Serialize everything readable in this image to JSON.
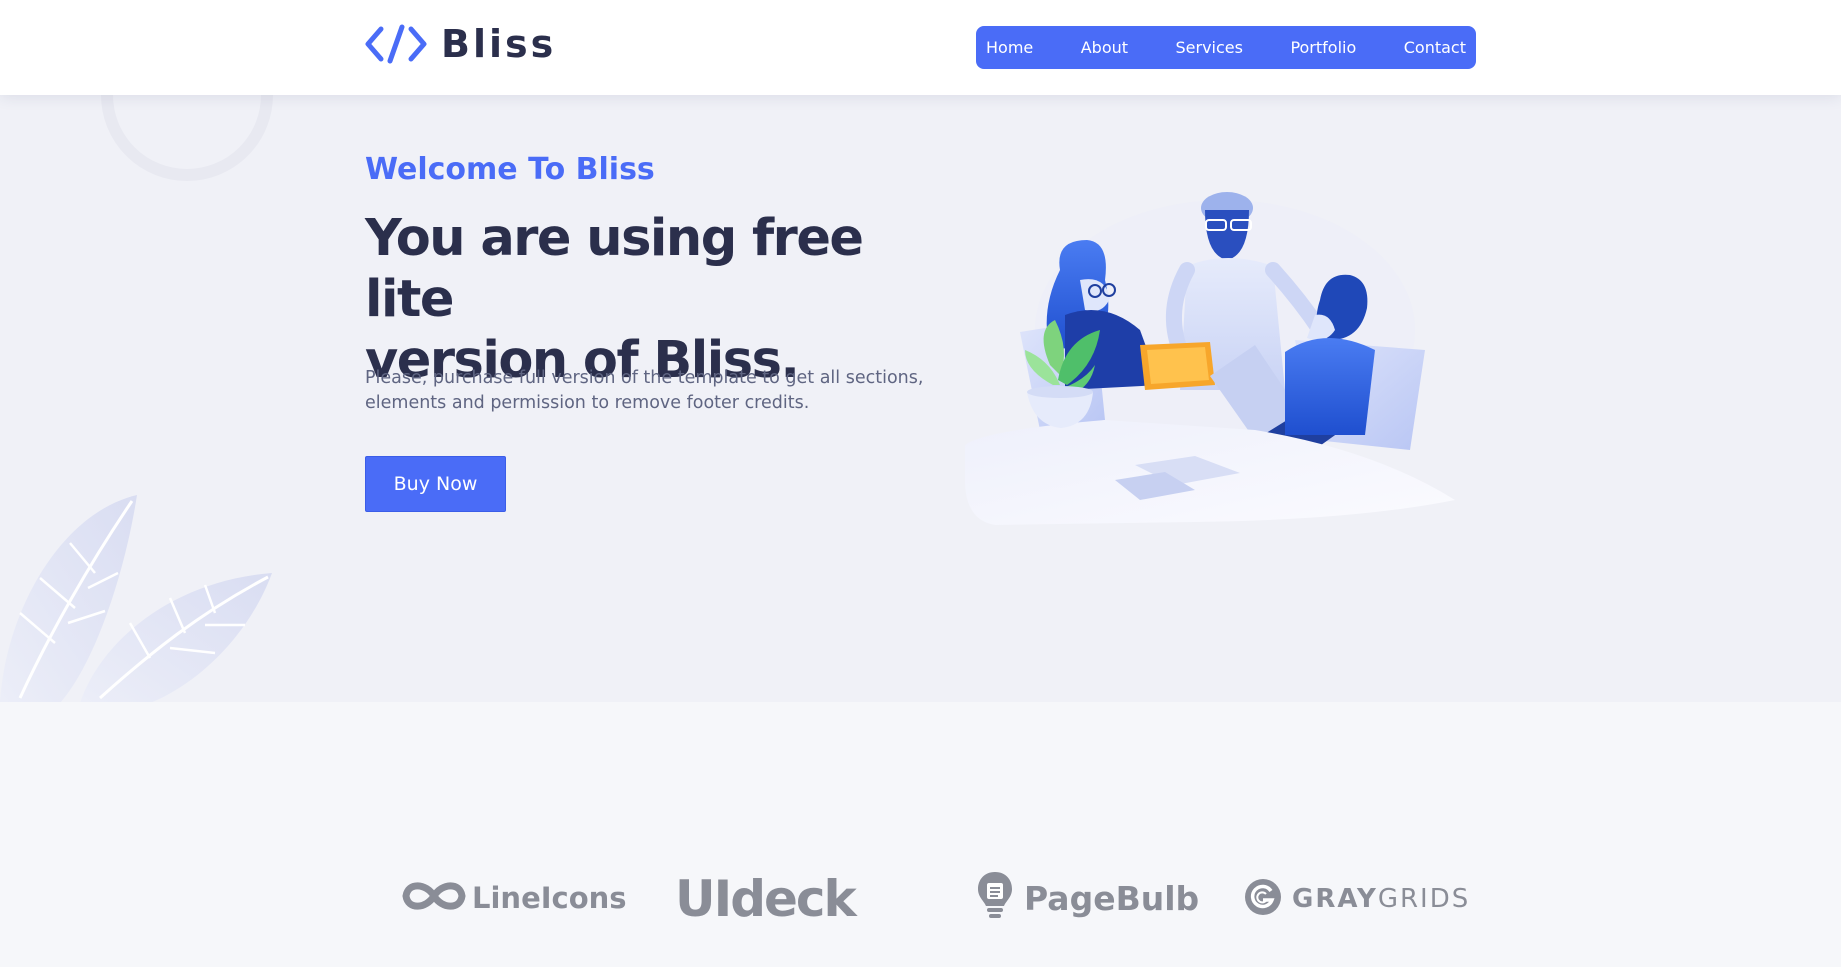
{
  "brand": {
    "name": "Bliss"
  },
  "nav": {
    "items": [
      "Home",
      "About",
      "Services",
      "Portfolio",
      "Contact"
    ]
  },
  "hero": {
    "kicker": "Welcome To Bliss",
    "headline_line1": "You are using free lite",
    "headline_line2": "version of Bliss.",
    "description_line1": "Please, purchase full version of the template to get all sections,",
    "description_line2": "elements and permission to remove footer credits.",
    "cta_label": "Buy Now"
  },
  "partners": {
    "lineicons": "LineIcons",
    "uideck": "UIdeck",
    "pagebulb": "PageBulb",
    "graygrids_gray": "GRAY",
    "graygrids_grids": "GRIDS"
  },
  "colors": {
    "accent": "#4a6cf7",
    "heading": "#2b2f4c",
    "body_text": "#5f6582",
    "logo_gray": "#8a8d97"
  },
  "icons": [
    "code-icon",
    "lineicons-infinity-icon",
    "pagebulb-bulb-icon",
    "graygrids-g-icon"
  ]
}
